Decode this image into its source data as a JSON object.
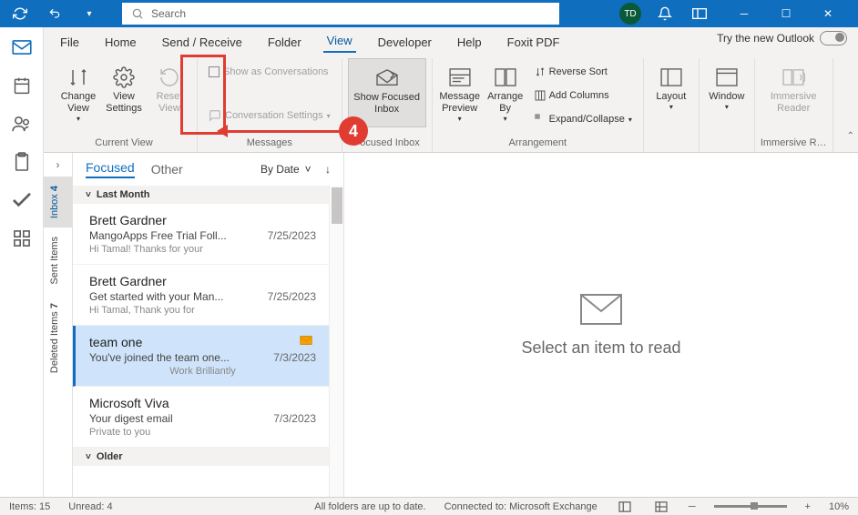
{
  "titlebar": {
    "search_placeholder": "Search",
    "user_initials": "TD"
  },
  "tabs": {
    "file": "File",
    "home": "Home",
    "sendreceive": "Send / Receive",
    "folder": "Folder",
    "view": "View",
    "developer": "Developer",
    "help": "Help",
    "foxit": "Foxit PDF",
    "trynew": "Try the new Outlook",
    "toggle": "Off"
  },
  "ribbon": {
    "change_view": "Change View",
    "view_settings": "View Settings",
    "reset_view": "Reset View",
    "group_currentview": "Current View",
    "show_conv": "Show as Conversations",
    "conv_settings": "Conversation Settings",
    "group_messages": "Messages",
    "show_focused": "Show Focused Inbox",
    "group_focused": "Focused Inbox",
    "msg_preview": "Message Preview",
    "arrange_by": "Arrange By",
    "reverse_sort": "Reverse Sort",
    "add_columns": "Add Columns",
    "expand_collapse": "Expand/Collapse",
    "group_arrangement": "Arrangement",
    "layout": "Layout",
    "window": "Window",
    "immersive": "Immersive Reader",
    "group_immersive": "Immersive R…"
  },
  "annotation": {
    "step": "4"
  },
  "folders": {
    "inbox": "Inbox",
    "inbox_count": "4",
    "sent": "Sent Items",
    "deleted": "Deleted Items",
    "deleted_count": "7"
  },
  "messagelist": {
    "tab_focused": "Focused",
    "tab_other": "Other",
    "sort": "By Date",
    "group_lastmonth": "Last Month",
    "group_older": "Older",
    "items": [
      {
        "from": "Brett Gardner",
        "subject": "MangoApps Free Trial Foll...",
        "date": "7/25/2023",
        "preview": "Hi Tamal!  Thanks for your"
      },
      {
        "from": "Brett Gardner",
        "subject": "Get started with your Man...",
        "date": "7/25/2023",
        "preview": "Hi Tamal,   Thank you for"
      },
      {
        "from": "team one",
        "subject": "You've joined the team one...",
        "date": "7/3/2023",
        "preview": "Work Brilliantly"
      },
      {
        "from": "Microsoft Viva",
        "subject": "Your digest email",
        "date": "7/3/2023",
        "preview": "Private to you"
      }
    ]
  },
  "reading": {
    "placeholder": "Select an item to read"
  },
  "statusbar": {
    "items": "Items: 15",
    "unread": "Unread: 4",
    "sync": "All folders are up to date.",
    "connected": "Connected to: Microsoft Exchange",
    "zoom": "10%"
  }
}
